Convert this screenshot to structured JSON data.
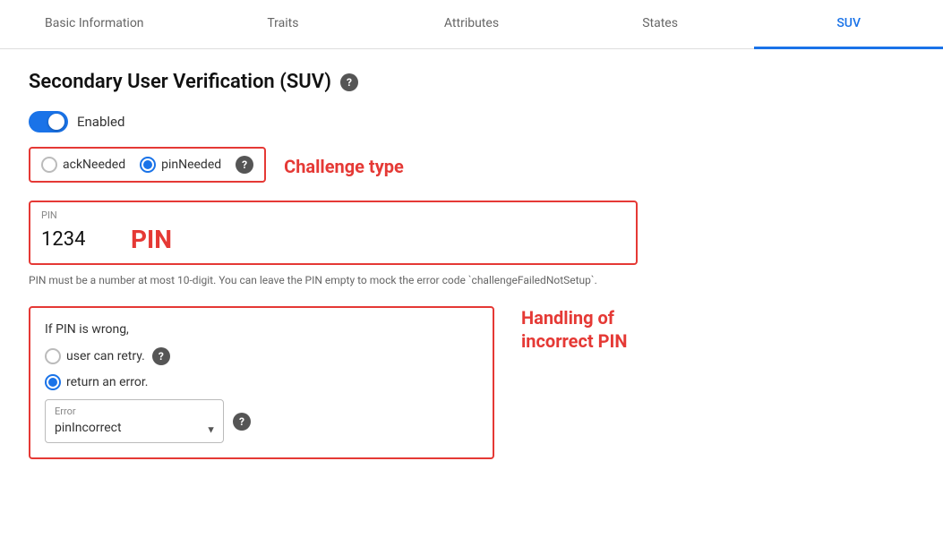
{
  "tabs": [
    {
      "id": "basic-information",
      "label": "Basic Information",
      "active": false
    },
    {
      "id": "traits",
      "label": "Traits",
      "active": false
    },
    {
      "id": "attributes",
      "label": "Attributes",
      "active": false
    },
    {
      "id": "states",
      "label": "States",
      "active": false
    },
    {
      "id": "suv",
      "label": "SUV",
      "active": true
    }
  ],
  "page": {
    "title": "Secondary User Verification (SUV)",
    "toggle_label": "Enabled",
    "toggle_enabled": true,
    "challenge_type_annotation": "Challenge type",
    "challenge_type_options": [
      {
        "id": "ack-needed",
        "label": "ackNeeded",
        "selected": false
      },
      {
        "id": "pin-needed",
        "label": "pinNeeded",
        "selected": true
      }
    ],
    "pin_section": {
      "field_label": "PIN",
      "value": "1234",
      "annotation": "PIN",
      "hint": "PIN must be a number at most 10-digit. You can leave the PIN empty to mock the error code `challengeFailedNotSetup`."
    },
    "handling_section": {
      "title": "If PIN is wrong,",
      "annotation": "Handling of\nincorrect PIN",
      "options": [
        {
          "id": "user-retry",
          "label": "user can retry.",
          "selected": false,
          "has_help": true
        },
        {
          "id": "return-error",
          "label": "return an error.",
          "selected": true,
          "has_help": false
        }
      ],
      "error_field": {
        "label": "Error",
        "value": "pinIncorrect"
      }
    }
  }
}
